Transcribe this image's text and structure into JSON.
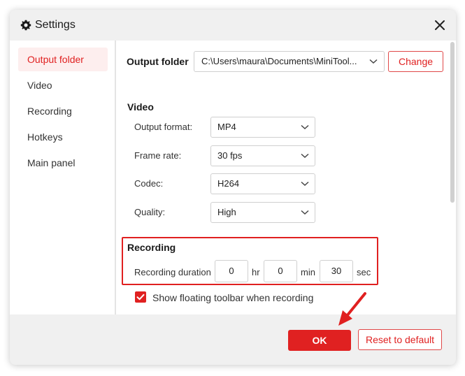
{
  "dialog": {
    "title": "Settings",
    "icons": {
      "title": "gear-icon",
      "close": "close-icon"
    }
  },
  "sidebar": {
    "items": [
      {
        "label": "Output folder",
        "active": true
      },
      {
        "label": "Video",
        "active": false
      },
      {
        "label": "Recording",
        "active": false
      },
      {
        "label": "Hotkeys",
        "active": false
      },
      {
        "label": "Main panel",
        "active": false
      }
    ]
  },
  "output_folder": {
    "label": "Output folder",
    "path": "C:\\Users\\maura\\Documents\\MiniTool...",
    "change_label": "Change"
  },
  "video": {
    "heading": "Video",
    "format_label": "Output format:",
    "format_value": "MP4",
    "frame_rate_label": "Frame rate:",
    "frame_rate_value": "30 fps",
    "codec_label": "Codec:",
    "codec_value": "H264",
    "quality_label": "Quality:",
    "quality_value": "High"
  },
  "recording": {
    "heading": "Recording",
    "duration_label": "Recording duration",
    "hr_value": "0",
    "hr_unit": "hr",
    "min_value": "0",
    "min_unit": "min",
    "sec_value": "30",
    "sec_unit": "sec",
    "floating_toolbar_label": "Show floating toolbar when recording",
    "floating_toolbar_checked": true
  },
  "footer": {
    "ok_label": "OK",
    "reset_label": "Reset to default"
  },
  "colors": {
    "accent": "#e02121",
    "active_bg": "#fdeeee",
    "highlight_border": "#e02020"
  }
}
